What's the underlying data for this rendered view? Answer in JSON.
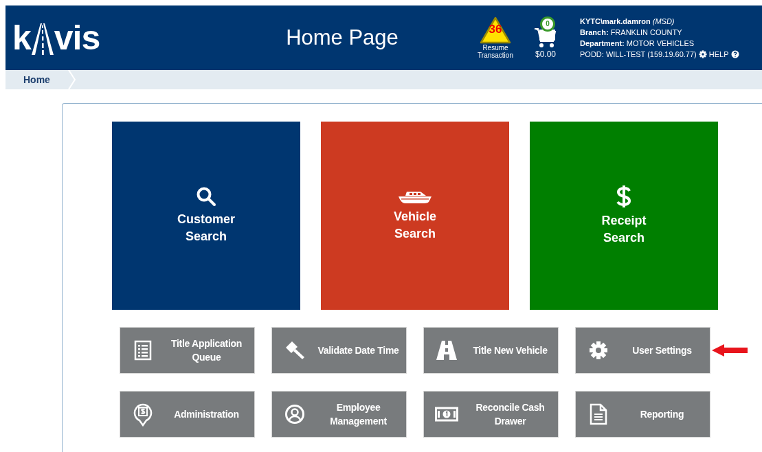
{
  "header": {
    "logo": {
      "before": "k",
      "after": "vis"
    },
    "title": "Home Page",
    "resume": {
      "count": "36",
      "label": "Resume Transaction"
    },
    "cart": {
      "count": "0",
      "total": "$0.00"
    },
    "user": {
      "name": "KYTC\\mark.damron",
      "role": "(MSD)",
      "branch_label": "Branch:",
      "branch": "FRANKLIN COUNTY",
      "department_label": "Department:",
      "department": "MOTOR VEHICLES",
      "podd": "PODD: WILL-TEST (159.19.60.77)",
      "help": "HELP"
    }
  },
  "breadcrumb": [
    {
      "label": "Home"
    }
  ],
  "tiles": [
    {
      "kind": "search",
      "label": "Customer Search",
      "color": "#003670"
    },
    {
      "kind": "boat",
      "label": "Vehicle Search",
      "color": "#cd3a21"
    },
    {
      "kind": "dollar",
      "label": "Receipt Search",
      "color": "#007f00"
    }
  ],
  "actions": [
    {
      "kind": "list",
      "label": "Title Application Queue",
      "pointed": false
    },
    {
      "kind": "gavel",
      "label": "Validate Date Time",
      "pointed": false
    },
    {
      "kind": "road",
      "label": "Title New Vehicle",
      "pointed": false
    },
    {
      "kind": "gear",
      "label": "User Settings",
      "pointed": true
    },
    {
      "kind": "atm",
      "label": "Administration",
      "pointed": false
    },
    {
      "kind": "person",
      "label": "Employee Management",
      "pointed": false
    },
    {
      "kind": "cash",
      "label": "Reconcile Cash Drawer",
      "pointed": false
    },
    {
      "kind": "document",
      "label": "Reporting",
      "pointed": false
    }
  ]
}
